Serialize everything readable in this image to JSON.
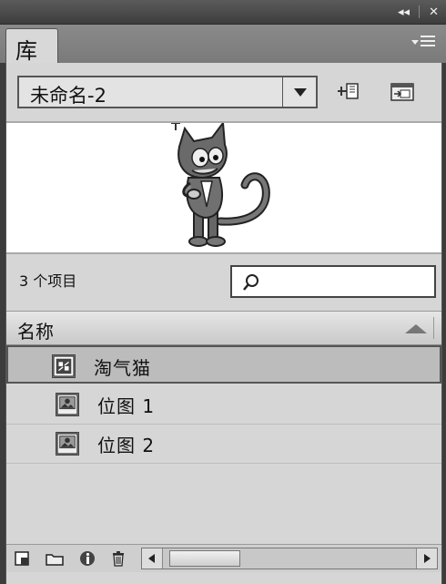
{
  "panel": {
    "tab_label": "库",
    "titlebar_controls": [
      "collapse-icon",
      "close-icon"
    ],
    "menu_icon": "panel-menu-icon"
  },
  "document_select": {
    "value": "未命名-2"
  },
  "toolbar": {
    "pin_icon": "pin-library-icon",
    "new_library_icon": "new-library-panel-icon"
  },
  "preview": {
    "content": "cat-character-preview"
  },
  "library": {
    "item_count_label": "3 个项目",
    "search_placeholder": "",
    "column_header": "名称",
    "items": [
      {
        "name": "淘气猫",
        "icon": "movieclip-symbol-icon",
        "selected": true
      },
      {
        "name": "位图 1",
        "icon": "bitmap-icon",
        "selected": false
      },
      {
        "name": "位图 2",
        "icon": "bitmap-icon",
        "selected": false
      }
    ]
  },
  "footer": {
    "icons": [
      "new-symbol-icon",
      "new-folder-icon",
      "properties-icon",
      "delete-icon"
    ]
  },
  "colors": {
    "panel_bg": "#d6d6d6",
    "header_bg": "#3c3c3c",
    "selection": "#bcbcbc"
  }
}
